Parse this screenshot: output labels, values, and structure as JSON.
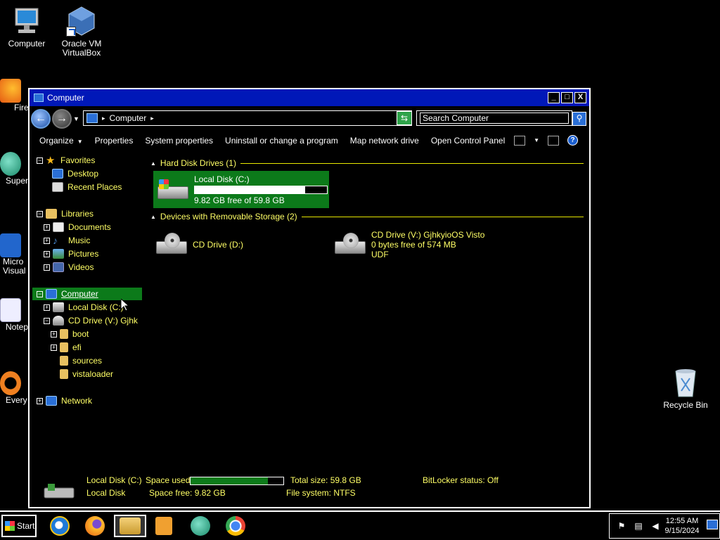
{
  "desktop": {
    "icons": [
      {
        "label": "Computer",
        "icon": "computer-icon"
      },
      {
        "label": "Oracle VM VirtualBox",
        "icon": "virtualbox-icon"
      },
      {
        "label": "Recycle Bin",
        "icon": "recycle-bin-icon"
      }
    ],
    "partial_icons": [
      {
        "label": "Fire",
        "icon": "firefox-icon"
      },
      {
        "label": "Super",
        "icon": "app-icon"
      },
      {
        "label": "Micro Visual",
        "icon": "visual-studio-icon"
      },
      {
        "label": "Notep",
        "icon": "notepad-icon"
      },
      {
        "label": "Every",
        "icon": "everything-icon"
      }
    ]
  },
  "window": {
    "title": "Computer",
    "buttons": {
      "minimize": "_",
      "maximize": "□",
      "close": "X"
    },
    "address": {
      "crumb": "Computer"
    },
    "search": {
      "placeholder": "Search Computer"
    },
    "toolbar": {
      "organize": "Organize",
      "properties": "Properties",
      "system_properties": "System properties",
      "uninstall": "Uninstall or change a program",
      "map_drive": "Map network drive",
      "control_panel": "Open Control Panel"
    },
    "nav": {
      "favorites": "Favorites",
      "desktop": "Desktop",
      "recent_places": "Recent Places",
      "libraries": "Libraries",
      "documents": "Documents",
      "music": "Music",
      "pictures": "Pictures",
      "videos": "Videos",
      "computer": "Computer",
      "local_disk": "Local Disk (C:)",
      "cd_drive": "CD Drive (V:) Gjhk",
      "boot": "boot",
      "efi": "efi",
      "sources": "sources",
      "vistaloader": "vistaloader",
      "network": "Network"
    },
    "content": {
      "hdd_group": "Hard Disk Drives (1)",
      "local_disk": {
        "name": "Local Disk (C:)",
        "free": "9.82 GB free of 59.8 GB",
        "used_fraction": 0.836
      },
      "removable_group": "Devices with Removable Storage (2)",
      "cd_d": {
        "name": "CD Drive (D:)"
      },
      "cd_v": {
        "name": "CD Drive (V:) GjhkyioOS Visto",
        "free": "0 bytes free of 574 MB",
        "fs": "UDF"
      }
    },
    "details": {
      "name": "Local Disk (C:)",
      "type": "Local Disk",
      "space_used_label": "Space used:",
      "space_used_fraction": 0.836,
      "space_free": "Space free: 9.82 GB",
      "total_size": "Total size: 59.8 GB",
      "file_system": "File system: NTFS",
      "bitlocker": "BitLocker status: Off"
    }
  },
  "taskbar": {
    "start_label": "Start",
    "apps": [
      "internet-explorer-icon",
      "firefox-icon",
      "file-explorer-icon",
      "media-player-icon",
      "app-icon",
      "chrome-icon"
    ],
    "clock_time": "12:55 AM",
    "clock_date": "9/15/2024"
  }
}
